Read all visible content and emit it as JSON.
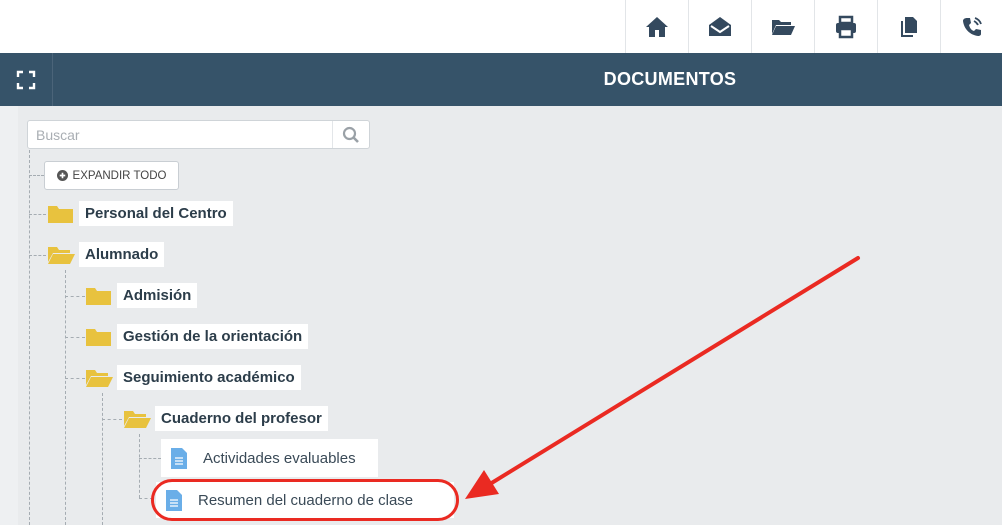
{
  "topbar": {
    "buttons": [
      {
        "icon": "home-icon",
        "name": "home-button"
      },
      {
        "icon": "envelope-icon",
        "name": "messages-button"
      },
      {
        "icon": "folder-open-icon",
        "name": "documents-button"
      },
      {
        "icon": "printer-icon",
        "name": "print-button"
      },
      {
        "icon": "copy-icon",
        "name": "copy-button"
      },
      {
        "icon": "phone-icon",
        "name": "phone-button"
      }
    ]
  },
  "header": {
    "title": "DOCUMENTOS",
    "expand_icon": "fullscreen-icon"
  },
  "search": {
    "placeholder": "Buscar",
    "value": ""
  },
  "toolbar": {
    "expand_all_label": "EXPANDIR TODO"
  },
  "tree": {
    "personal": "Personal del Centro",
    "alumnado": "Alumnado",
    "admision": "Admisión",
    "orientacion": "Gestión de la orientación",
    "seguimiento": "Seguimiento académico",
    "cuaderno": "Cuaderno del profesor",
    "actividades": "Actividades evaluables",
    "resumen": "Resumen del cuaderno de clase"
  },
  "colors": {
    "header_bg": "#365369",
    "folder": "#e8c23e",
    "file": "#6aaee8",
    "annotation": "#ea2a22"
  }
}
